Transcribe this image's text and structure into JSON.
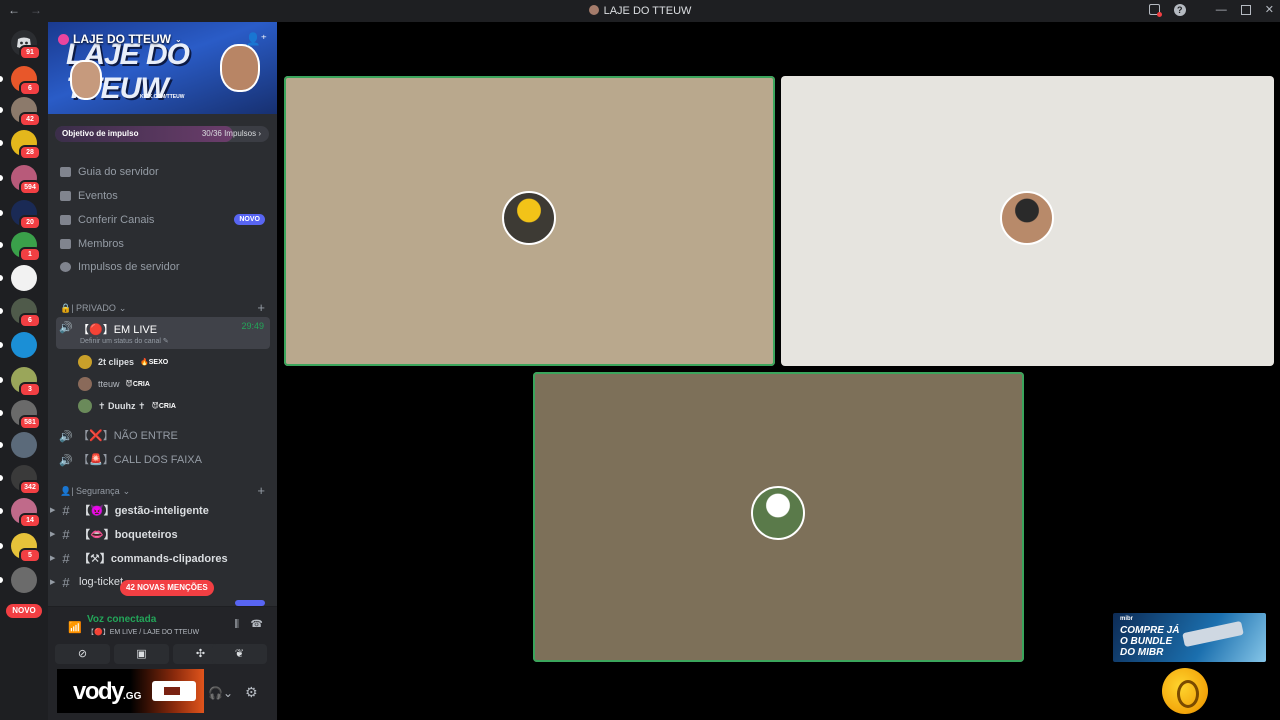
{
  "titlebar": {
    "title": "LAJE DO TTEUW",
    "back": "←",
    "forward": "→",
    "help": "?",
    "minimize": "—",
    "maximize": "",
    "close": "✕"
  },
  "rail": {
    "dm_badge": "91",
    "servers": [
      {
        "badge": "6",
        "color": "#e8572a"
      },
      {
        "badge": "42",
        "color": "#8c7a6b"
      },
      {
        "badge": "28",
        "color": "#e3b71c"
      },
      {
        "badge": "594",
        "color": "#b85a7a"
      },
      {
        "badge": "20",
        "color": "#1a2a55"
      },
      {
        "badge": "1",
        "color": "#3aa04a"
      },
      {
        "badge": "",
        "color": "#f2f2f2"
      },
      {
        "badge": "6",
        "color": "#4f5a4a"
      },
      {
        "badge": "",
        "color": "#1b8fd6"
      },
      {
        "badge": "3",
        "color": "#9aa65a"
      },
      {
        "badge": "581",
        "color": "#6a6a6a"
      },
      {
        "badge": "",
        "color": "#5b6a7a"
      },
      {
        "badge": "342",
        "color": "#3a3a3a"
      },
      {
        "badge": "14",
        "color": "#c06a8a"
      },
      {
        "badge": "5",
        "color": "#e6c23a"
      },
      {
        "badge": "",
        "color": "#6b6b6b"
      }
    ],
    "novo_label": "NOVO"
  },
  "server": {
    "name": "LAJE DO TTEUW",
    "banner_text": "LAJE DO TTEUW",
    "banner_sub": "KICK.COM/TTEUW",
    "boost_label": "Objetivo de impulso",
    "boost_count": "30/36 Impulsos",
    "boost_progress": 0.83
  },
  "nav": {
    "guide": "Guia do servidor",
    "events": "Eventos",
    "browse": "Conferir Canais",
    "browse_badge": "NOVO",
    "members": "Membros",
    "boosts": "Impulsos de servidor"
  },
  "categories": {
    "private": "🔒| PRIVADO",
    "security": "👤| Segurança"
  },
  "voice_channels": {
    "live_name": "【🔴】EM LIVE",
    "live_timer": "29:49",
    "live_status": "Definir um status do canal",
    "users": [
      {
        "name": "2t clipes",
        "tag": "🔥SEXO",
        "color": "#c9a02a"
      },
      {
        "name": "tteuw",
        "tag": "😈CRIA",
        "color": "#8a6a5a"
      },
      {
        "name": "✝ Duuhz ✝",
        "tag": "😈CRIA",
        "color": "#6a8a5a"
      }
    ],
    "nao_entre": "【❌】NÃO ENTRE",
    "call_faixa": "【🚨】CALL DOS FAIXA"
  },
  "text_channels": [
    {
      "name": "【👿】gestão-inteligente"
    },
    {
      "name": "【👄】boqueteiros"
    },
    {
      "name": "【⚒】commands-clipadores"
    },
    {
      "name": "log-ticket"
    }
  ],
  "mentions_pill": "42 NOVAS MENÇÕES",
  "voice_panel": {
    "status": "Voz conectada",
    "channel": "【🔴】EM LIVE / LAJE DO TTEUW"
  },
  "user_panel": {
    "nameplate_text": "vody",
    "nameplate_domain": ".GG"
  },
  "stage": {
    "tiles": [
      {
        "bg": "#b9a88d",
        "speaking": true,
        "avatar_color": "#3d3a34",
        "avatar_accent": "#f2c318"
      },
      {
        "bg": "#e6e4df",
        "speaking": false,
        "avatar_color": "#b88a6a",
        "avatar_accent": "#2a2a2a"
      },
      {
        "bg": "#7d7059",
        "speaking": true,
        "avatar_color": "#5a7a4a",
        "avatar_accent": "#ffffff"
      }
    ]
  },
  "promo": {
    "brand": "mibr",
    "text_line1": "COMPRE JÁ",
    "text_line2": "O BUNDLE",
    "text_line3": "DO MIBR"
  }
}
